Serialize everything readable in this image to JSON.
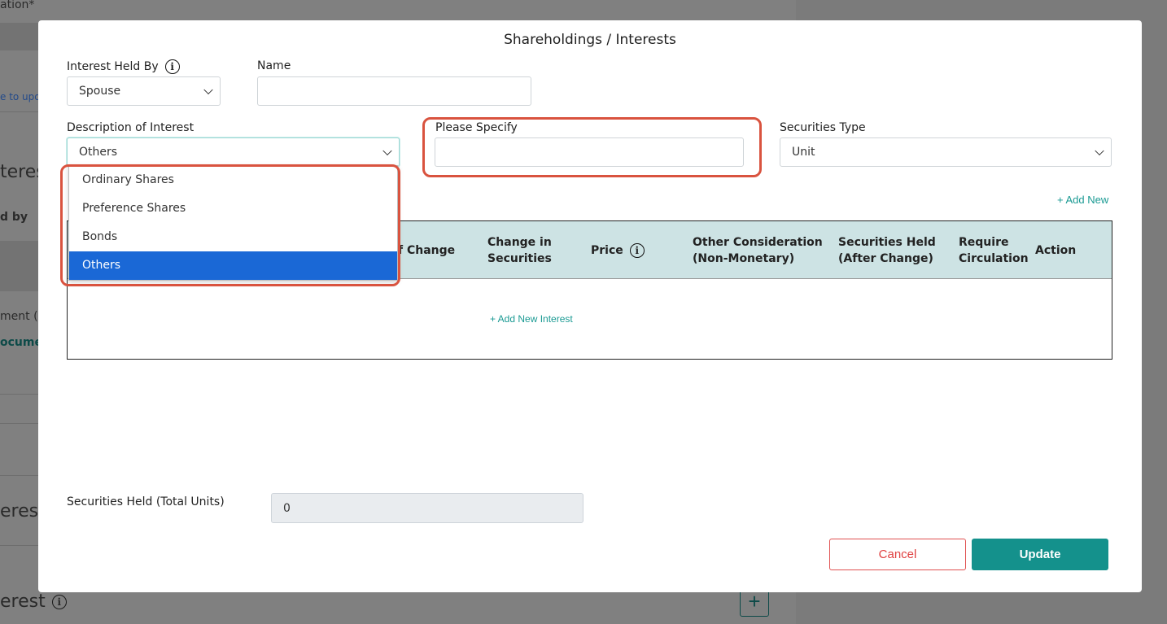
{
  "background": {
    "texts": [
      "ation*",
      "e to upd",
      "teres",
      "d by",
      "ment (O",
      "ocume",
      "erest",
      "erest"
    ],
    "plus_label": "+"
  },
  "modal": {
    "title": "Shareholdings / Interests",
    "interest_held_by": {
      "label": "Interest Held By",
      "value": "Spouse"
    },
    "name": {
      "label": "Name",
      "value": ""
    },
    "description_of_interest": {
      "label": "Description of Interest",
      "value": "Others",
      "options": [
        "Ordinary Shares",
        "Preference Shares",
        "Bonds",
        "Others"
      ],
      "selected_index": 3
    },
    "please_specify": {
      "label": "Please Specify",
      "value": ""
    },
    "securities_type": {
      "label": "Securities Type",
      "value": "Unit"
    },
    "add_new_label": "+ Add New",
    "table": {
      "headers": [
        "f Change",
        "Change in Securities",
        "Price",
        "Other Consideration (Non-Monetary)",
        "Securities Held (After Change)",
        "Require Circulation",
        "Action"
      ],
      "add_interest_label": "+ Add New Interest"
    },
    "securities_held_total": {
      "label": "Securities Held (Total Units)",
      "value": "0"
    },
    "cancel_label": "Cancel",
    "update_label": "Update"
  },
  "colors": {
    "accent": "#14918c",
    "highlight": "#d9533f",
    "selected_option": "#1a68d6",
    "table_header": "#cde3e4"
  }
}
